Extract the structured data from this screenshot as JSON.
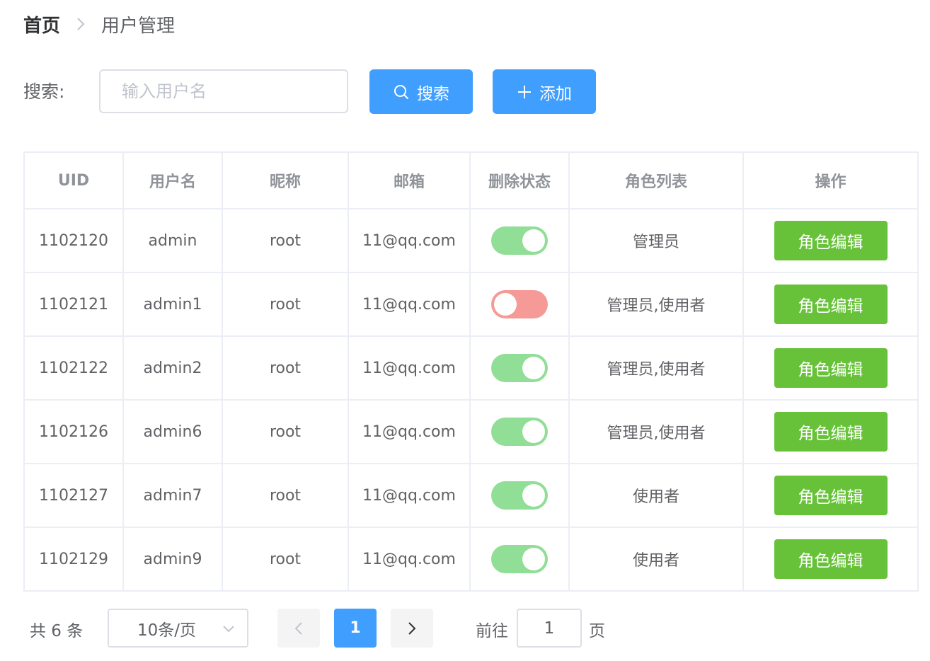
{
  "breadcrumb": {
    "home": "首页",
    "current": "用户管理"
  },
  "search": {
    "label": "搜索:",
    "placeholder": "输入用户名",
    "value": "",
    "search_button": "搜索",
    "add_button": "添加"
  },
  "table": {
    "headers": {
      "uid": "UID",
      "username": "用户名",
      "nickname": "昵称",
      "email": "邮箱",
      "deleted": "删除状态",
      "roles": "角色列表",
      "actions": "操作"
    },
    "rows": [
      {
        "uid": "1102120",
        "username": "admin",
        "nickname": "root",
        "email": "11@qq.com",
        "deleted_on": true,
        "roles": "管理员",
        "action": "角色编辑"
      },
      {
        "uid": "1102121",
        "username": "admin1",
        "nickname": "root",
        "email": "11@qq.com",
        "deleted_on": false,
        "roles": "管理员,使用者",
        "action": "角色编辑"
      },
      {
        "uid": "1102122",
        "username": "admin2",
        "nickname": "root",
        "email": "11@qq.com",
        "deleted_on": true,
        "roles": "管理员,使用者",
        "action": "角色编辑"
      },
      {
        "uid": "1102126",
        "username": "admin6",
        "nickname": "root",
        "email": "11@qq.com",
        "deleted_on": true,
        "roles": "管理员,使用者",
        "action": "角色编辑"
      },
      {
        "uid": "1102127",
        "username": "admin7",
        "nickname": "root",
        "email": "11@qq.com",
        "deleted_on": true,
        "roles": "使用者",
        "action": "角色编辑"
      },
      {
        "uid": "1102129",
        "username": "admin9",
        "nickname": "root",
        "email": "11@qq.com",
        "deleted_on": true,
        "roles": "使用者",
        "action": "角色编辑"
      }
    ]
  },
  "pagination": {
    "total": "共 6 条",
    "page_size": "10条/页",
    "current_page": "1",
    "goto_label": "前往",
    "goto_value": "1",
    "goto_suffix": "页"
  },
  "colors": {
    "primary": "#409eff",
    "success": "#67c23a",
    "switch_on": "#91de97",
    "switch_off": "#f69a97"
  },
  "icons": {
    "breadcrumb_separator": "chevron-right-icon",
    "search_button": "search-icon",
    "add_button": "plus-icon",
    "page_size": "chevron-down-icon",
    "prev": "chevron-left-icon",
    "next": "chevron-right-icon"
  }
}
